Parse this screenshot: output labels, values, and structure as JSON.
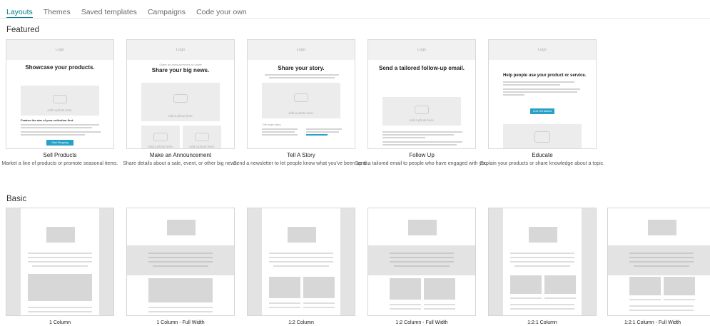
{
  "tabs": [
    {
      "label": "Layouts",
      "active": true
    },
    {
      "label": "Themes",
      "active": false
    },
    {
      "label": "Saved templates",
      "active": false
    },
    {
      "label": "Campaigns",
      "active": false
    },
    {
      "label": "Code your own",
      "active": false
    }
  ],
  "sections": {
    "featured": "Featured",
    "basic": "Basic"
  },
  "featured": [
    {
      "name": "Sell Products",
      "desc": "Market a line of products or promote seasonal items.",
      "thumb": {
        "logo": "Logo",
        "headline": "Showcase your products.",
        "photo": "Add a photo here.",
        "feature": "Feature the star of your collection first.",
        "button": "Start Shopping"
      }
    },
    {
      "name": "Make an Announcement",
      "desc": "Share details about a sale, event, or other big news.",
      "thumb": {
        "logo": "Logo",
        "kicker": "Share an announcement or invite!",
        "headline": "Share your big news.",
        "photo": "Add a photo here.",
        "photo2": "Add a photo here.",
        "photo3": "Add a photo here."
      }
    },
    {
      "name": "Tell A Story",
      "desc": "Send a newsletter to let people know what you've been up to.",
      "thumb": {
        "logo": "Logo",
        "headline": "Share your story.",
        "photo": "Add a photo here.",
        "col_title": "The main story"
      }
    },
    {
      "name": "Follow Up",
      "desc": "Send a tailored email to people who have engaged with you.",
      "thumb": {
        "logo": "Logo",
        "headline": "Send a tailored follow-up email.",
        "photo": "Add a photo here."
      }
    },
    {
      "name": "Educate",
      "desc": "Explain your products or share knowledge about a topic.",
      "thumb": {
        "logo": "Logo",
        "headline": "Help people use your product or service.",
        "button": "Let's Get Started"
      }
    }
  ],
  "basic": [
    {
      "name": "1 Column"
    },
    {
      "name": "1 Column - Full Width"
    },
    {
      "name": "1:2 Column"
    },
    {
      "name": "1:2 Column - Full Width"
    },
    {
      "name": "1:2:1 Column"
    },
    {
      "name": "1:2:1 Column - Full Width"
    }
  ],
  "colors": {
    "accent": "#007c89",
    "button": "#28a1c8"
  }
}
